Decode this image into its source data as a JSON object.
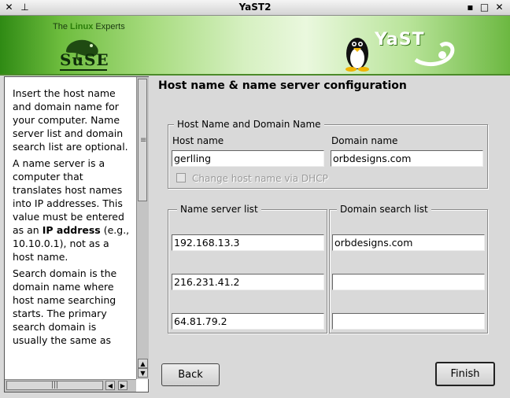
{
  "window": {
    "title": "YaST2",
    "menu_icon": "x-menu-icon",
    "pin_icon": "pin-icon",
    "minimize_icon": "minimize-icon",
    "maximize_icon": "maximize-icon",
    "close_icon": "close-icon"
  },
  "banner": {
    "tagline_prefix": "The ",
    "tagline_accent": "Linux",
    "tagline_suffix": " Experts",
    "suse_text": "SuSE",
    "yast_text": "YaST"
  },
  "help": {
    "paragraphs": [
      "Insert the host name and domain name for your computer. Name server list and domain search list are optional.",
      "A name server is a computer that translates host names into IP addresses. This value must be entered as an",
      "Search domain is the domain name where host name searching starts. The primary search domain is usually the same as"
    ],
    "bold_term": "IP address",
    "after_bold": " (e.g., 10.10.0.1), not as a host name."
  },
  "page": {
    "title": "Host name & name server configuration"
  },
  "host_frame": {
    "title": "Host Name and Domain Name",
    "host_label": "Host name",
    "host_value": "gerlling",
    "domain_label": "Domain name",
    "domain_value": "orbdesigns.com",
    "dhcp_label": "Change host name via DHCP"
  },
  "ns_frame": {
    "title": "Name server list",
    "values": [
      "192.168.13.3",
      "216.231.41.2",
      "64.81.79.2"
    ]
  },
  "search_frame": {
    "title": "Domain search list",
    "values": [
      "orbdesigns.com",
      "",
      ""
    ]
  },
  "buttons": {
    "back": "Back",
    "finish": "Finish"
  },
  "colors": {
    "banner_green": "#6ebd3e",
    "window_bg": "#d9d9d9"
  }
}
